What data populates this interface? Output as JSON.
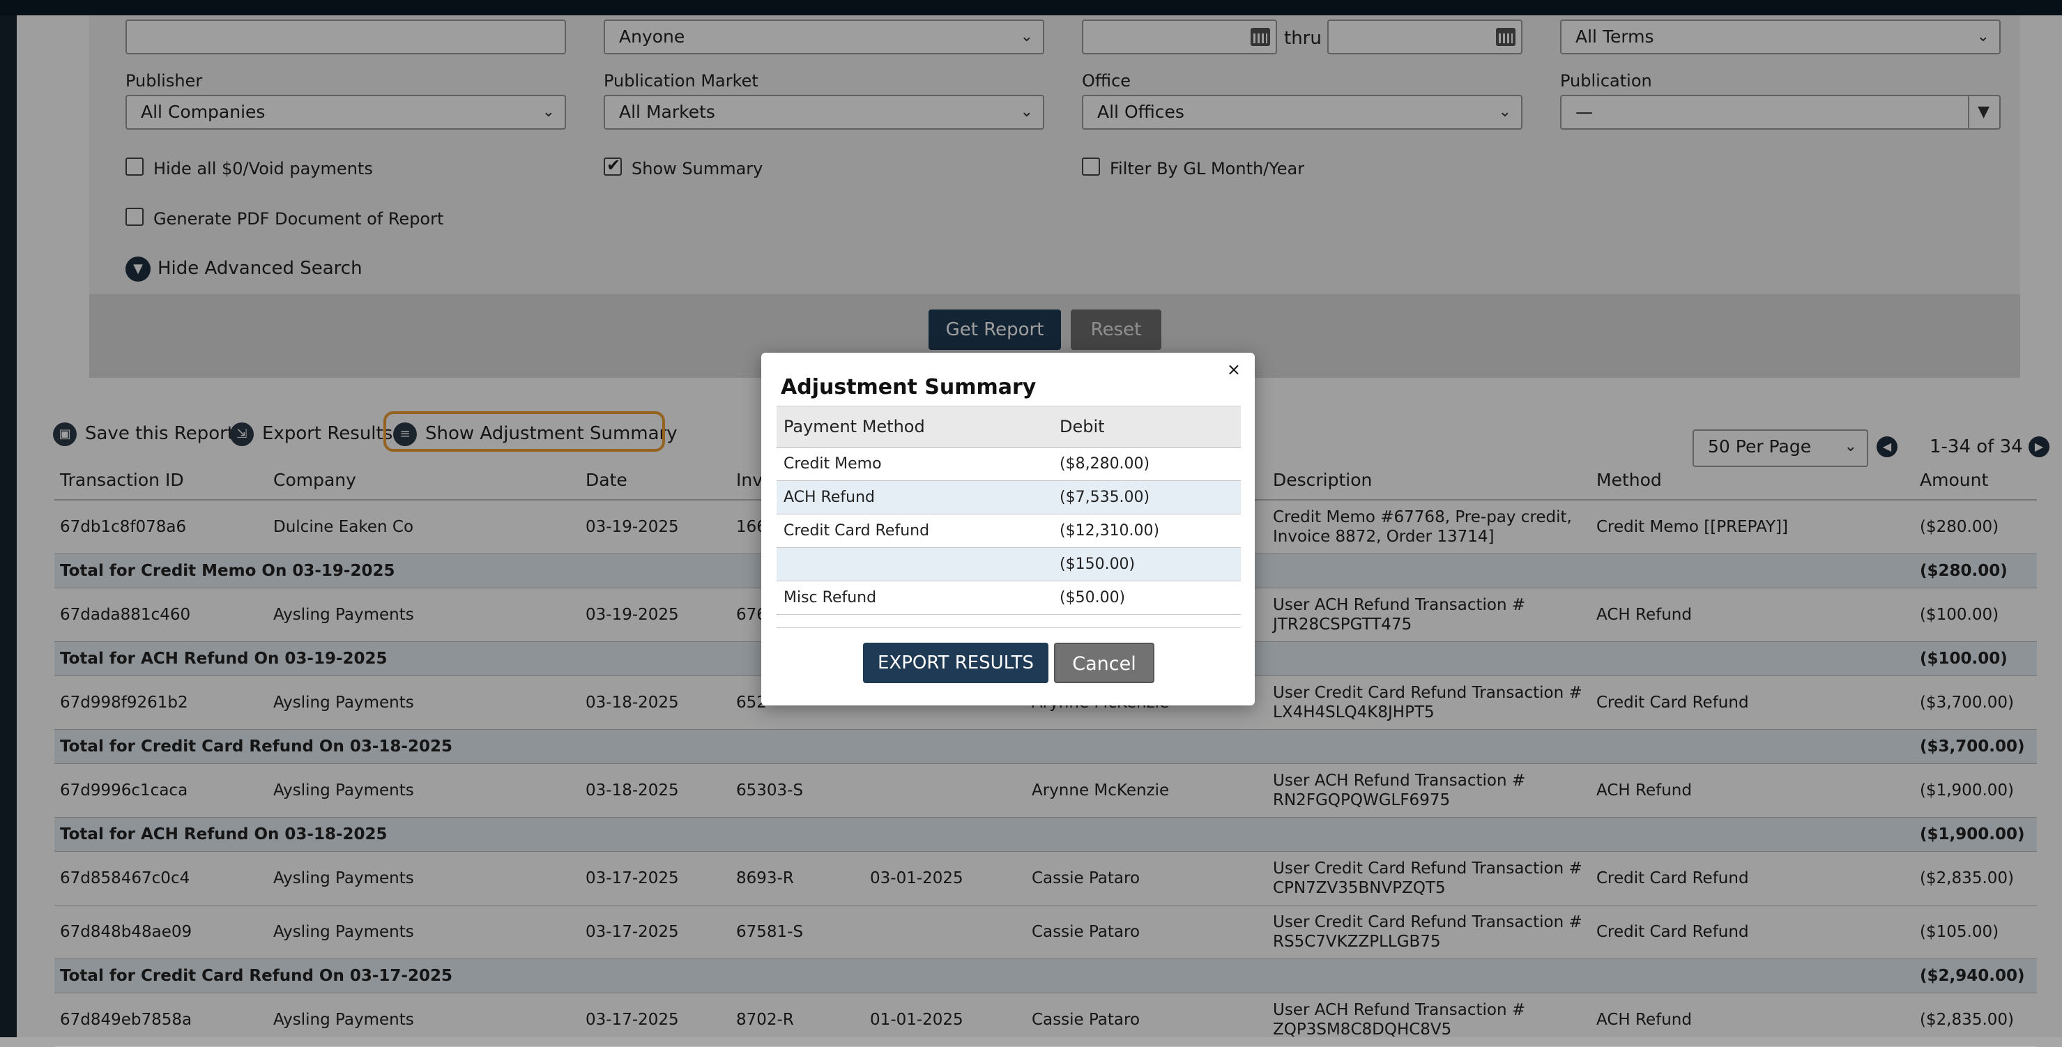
{
  "search": {
    "assigned_value": "Anyone",
    "date_thru": "thru",
    "terms_value": "All Terms",
    "publisher_label": "Publisher",
    "publisher_value": "All Companies",
    "market_label": "Publication Market",
    "market_value": "All Markets",
    "office_label": "Office",
    "office_value": "All Offices",
    "publication_label": "Publication",
    "publication_value": "—",
    "hide_void_label": "Hide all $0/Void payments",
    "show_summary_label": "Show Summary",
    "filter_gl_label": "Filter By GL Month/Year",
    "generate_pdf_label": "Generate PDF Document of Report",
    "hide_advanced_label": "Hide Advanced Search",
    "get_report_label": "Get Report",
    "reset_label": "Reset"
  },
  "toolbar": {
    "save_label": "Save this Report",
    "export_label": "Export Results",
    "show_adjustment_label": "Show Adjustment Summary",
    "per_page_value": "50 Per Page",
    "pager_text": "1-34 of 34"
  },
  "table": {
    "headers": [
      "Transaction ID",
      "Company",
      "Date",
      "Invoice",
      "",
      "",
      "Description",
      "Method",
      "Amount"
    ],
    "rows": [
      {
        "type": "row",
        "id": "67db1c8f078a6",
        "company": "Dulcine Eaken Co",
        "date": "03-19-2025",
        "invoice": "166",
        "due": "",
        "contact": "",
        "desc1": "Credit Memo #67768, Pre-pay credit,",
        "desc2": "Invoice 8872, Order 13714]",
        "method": "Credit Memo [[PREPAY]]",
        "amount": "($280.00)"
      },
      {
        "type": "total",
        "label": "Total for Credit Memo On 03-19-2025",
        "amount": "($280.00)"
      },
      {
        "type": "row",
        "id": "67dada881c460",
        "company": "Aysling Payments",
        "date": "03-19-2025",
        "invoice": "676",
        "due": "",
        "contact": "",
        "desc1": "User ACH Refund Transaction #",
        "desc2": "JTR28CSPGTT475",
        "method": "ACH Refund",
        "amount": "($100.00)"
      },
      {
        "type": "total",
        "label": "Total for ACH Refund On 03-19-2025",
        "amount": "($100.00)"
      },
      {
        "type": "row",
        "id": "67d998f9261b2",
        "company": "Aysling Payments",
        "date": "03-18-2025",
        "invoice": "652",
        "due": "",
        "contact": "Arynne McKenzie",
        "desc1": "User Credit Card Refund Transaction #",
        "desc2": "LX4H4SLQ4K8JHPT5",
        "method": "Credit Card Refund",
        "amount": "($3,700.00)"
      },
      {
        "type": "total",
        "label": "Total for Credit Card Refund On 03-18-2025",
        "amount": "($3,700.00)"
      },
      {
        "type": "row",
        "id": "67d9996c1caca",
        "company": "Aysling Payments",
        "date": "03-18-2025",
        "invoice": "65303-S",
        "due": "",
        "contact": "Arynne McKenzie",
        "desc1": "User ACH Refund Transaction #",
        "desc2": "RN2FGQPQWGLF6975",
        "method": "ACH Refund",
        "amount": "($1,900.00)"
      },
      {
        "type": "total",
        "label": "Total for ACH Refund On 03-18-2025",
        "amount": "($1,900.00)"
      },
      {
        "type": "row",
        "id": "67d858467c0c4",
        "company": "Aysling Payments",
        "date": "03-17-2025",
        "invoice": "8693-R",
        "due": "03-01-2025",
        "contact": "Cassie Pataro",
        "desc1": "User Credit Card Refund Transaction #",
        "desc2": "CPN7ZV35BNVPZQT5",
        "method": "Credit Card Refund",
        "amount": "($2,835.00)"
      },
      {
        "type": "row",
        "id": "67d848b48ae09",
        "company": "Aysling Payments",
        "date": "03-17-2025",
        "invoice": "67581-S",
        "due": "",
        "contact": "Cassie Pataro",
        "desc1": "User Credit Card Refund Transaction #",
        "desc2": "RS5C7VKZZPLLGB75",
        "method": "Credit Card Refund",
        "amount": "($105.00)"
      },
      {
        "type": "total",
        "label": "Total for Credit Card Refund On 03-17-2025",
        "amount": "($2,940.00)"
      },
      {
        "type": "row",
        "id": "67d849eb7858a",
        "company": "Aysling Payments",
        "date": "03-17-2025",
        "invoice": "8702-R",
        "due": "01-01-2025",
        "contact": "Cassie Pataro",
        "desc1": "User ACH Refund Transaction #",
        "desc2": "ZQP3SM8C8DQHC8V5",
        "method": "ACH Refund",
        "amount": "($2,835.00)"
      }
    ]
  },
  "modal": {
    "close_glyph": "×",
    "title": "Adjustment Summary",
    "col_method": "Payment Method",
    "col_debit": "Debit",
    "rows": [
      {
        "method": "Credit Memo",
        "debit": "($8,280.00)"
      },
      {
        "method": "ACH Refund",
        "debit": "($7,535.00)"
      },
      {
        "method": "Credit Card Refund",
        "debit": "($12,310.00)"
      },
      {
        "method": "",
        "debit": "($150.00)"
      },
      {
        "method": "Misc Refund",
        "debit": "($50.00)"
      }
    ],
    "export_label": "EXPORT RESULTS",
    "cancel_label": "Cancel"
  }
}
